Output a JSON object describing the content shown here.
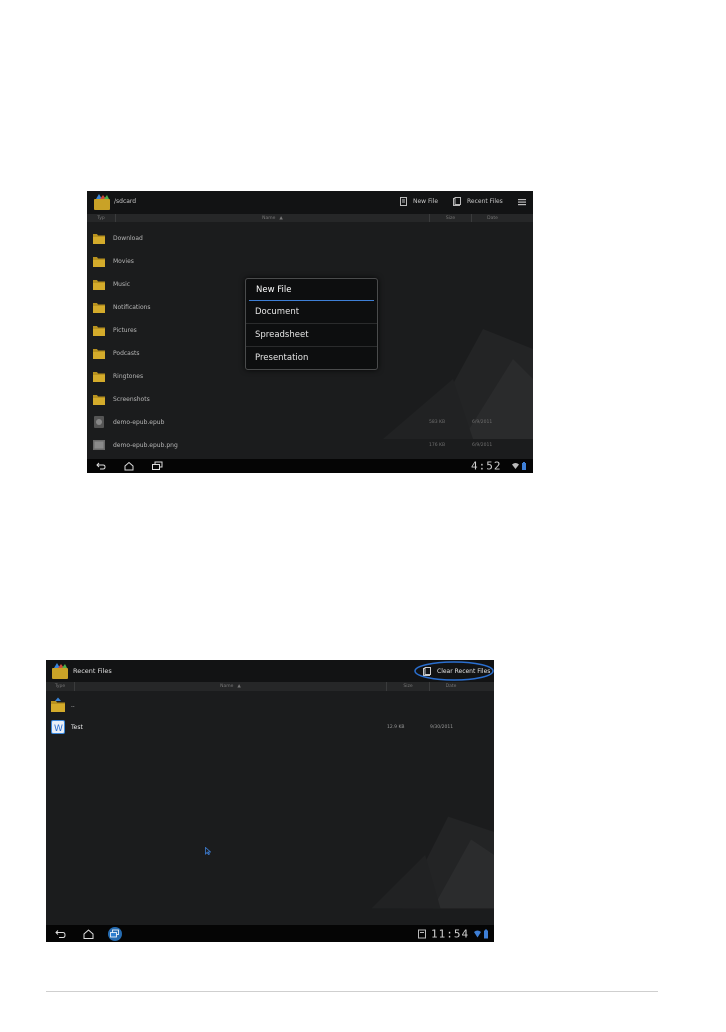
{
  "screen1": {
    "path": "/sdcard",
    "actions": {
      "new_file": "New File",
      "recent_files": "Recent Files"
    },
    "columns": {
      "type": "Typ",
      "name": "Name",
      "size": "Size",
      "date": "Date"
    },
    "rows": [
      {
        "name": "Download",
        "kind": "folder",
        "size": "",
        "date": ""
      },
      {
        "name": "Movies",
        "kind": "folder",
        "size": "",
        "date": ""
      },
      {
        "name": "Music",
        "kind": "folder",
        "size": "",
        "date": ""
      },
      {
        "name": "Notifications",
        "kind": "folder",
        "size": "",
        "date": ""
      },
      {
        "name": "Pictures",
        "kind": "folder",
        "size": "",
        "date": ""
      },
      {
        "name": "Podcasts",
        "kind": "folder",
        "size": "",
        "date": ""
      },
      {
        "name": "Ringtones",
        "kind": "folder",
        "size": "",
        "date": ""
      },
      {
        "name": "Screenshots",
        "kind": "folder",
        "size": "",
        "date": ""
      },
      {
        "name": "demo-epub.epub",
        "kind": "file",
        "size": "583 KB",
        "date": "6/9/2011"
      },
      {
        "name": "demo-epub.epub.png",
        "kind": "image",
        "size": "176 KB",
        "date": "6/9/2011"
      }
    ],
    "popup": {
      "title": "New File",
      "items": [
        "Document",
        "Spreadsheet",
        "Presentation"
      ]
    },
    "clock": "4:52"
  },
  "screen2": {
    "title": "Recent Files",
    "actions": {
      "clear": "Clear Recent Files"
    },
    "columns": {
      "type": "Type",
      "name": "Name",
      "size": "Size",
      "date": "Date"
    },
    "rows": [
      {
        "name": "..",
        "kind": "folder",
        "size": "",
        "date": ""
      },
      {
        "name": "Test",
        "kind": "document",
        "size": "12.9 KB",
        "date": "9/30/2011"
      }
    ],
    "clock": "11:54"
  },
  "colors": {
    "accent": "#3e7fd6",
    "folder": "#c9a227",
    "highlight_ring": "#2a6fd0"
  }
}
